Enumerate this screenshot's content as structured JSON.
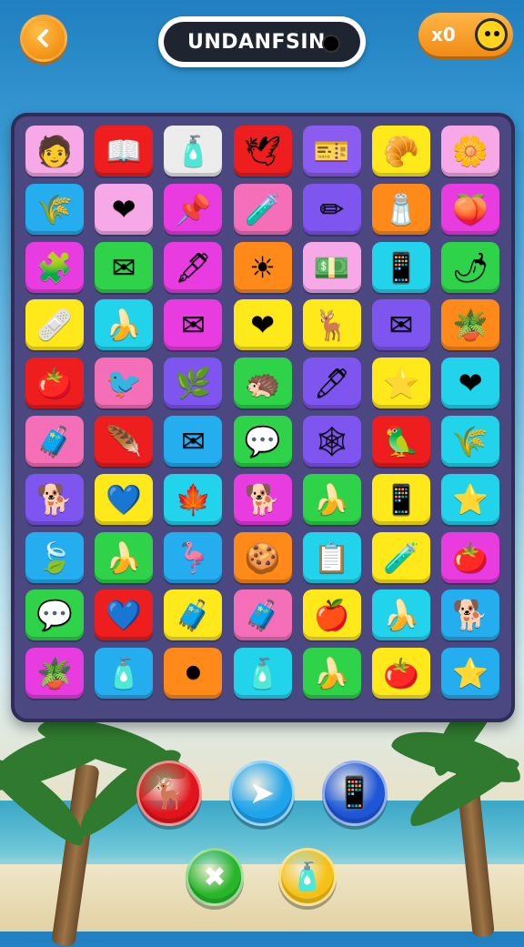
{
  "header": {
    "title": "UNDANFSIN",
    "coin_count": "x0",
    "back_icon": "back-arrow-icon"
  },
  "board": {
    "rows": [
      [
        {
          "icon": "🧑",
          "color": "#f7a8e6"
        },
        {
          "icon": "📖",
          "color": "#ef1e1e"
        },
        {
          "icon": "🧴",
          "color": "#ececec"
        },
        {
          "icon": "🕊",
          "color": "#ef1e1e"
        },
        {
          "icon": "🎫",
          "color": "#8a5cf0"
        },
        {
          "icon": "🥐",
          "color": "#ffe91a"
        },
        {
          "icon": "🌼",
          "color": "#f7a8e6"
        }
      ],
      [
        {
          "icon": "🌾",
          "color": "#24aef0"
        },
        {
          "icon": "❤",
          "color": "#f7a8e6"
        },
        {
          "icon": "📌",
          "color": "#e83be0"
        },
        {
          "icon": "🧪",
          "color": "#f56fb8"
        },
        {
          "icon": "✏",
          "color": "#7e55ee"
        },
        {
          "icon": "🧂",
          "color": "#ff8a1a"
        },
        {
          "icon": "🍑",
          "color": "#e83be0"
        }
      ],
      [
        {
          "icon": "🧩",
          "color": "#e83be0"
        },
        {
          "icon": "✉",
          "color": "#2ed34a"
        },
        {
          "icon": "🖋",
          "color": "#e83be0"
        },
        {
          "icon": "☀",
          "color": "#ff8a1a"
        },
        {
          "icon": "💵",
          "color": "#f7a8e6"
        },
        {
          "icon": "📱",
          "color": "#22d3ec"
        },
        {
          "icon": "🌶",
          "color": "#2ed34a"
        }
      ],
      [
        {
          "icon": "🩹",
          "color": "#ffe91a"
        },
        {
          "icon": "🍌",
          "color": "#22d3ec"
        },
        {
          "icon": "✉",
          "color": "#e83be0"
        },
        {
          "icon": "❤",
          "color": "#ffe91a"
        },
        {
          "icon": "🦌",
          "color": "#ffe91a"
        },
        {
          "icon": "✉",
          "color": "#7e55ee"
        },
        {
          "icon": "🪴",
          "color": "#ff8a1a"
        }
      ],
      [
        {
          "icon": "🍅",
          "color": "#ef1e1e"
        },
        {
          "icon": "🐦",
          "color": "#f56fb8"
        },
        {
          "icon": "🌿",
          "color": "#7e55ee"
        },
        {
          "icon": "🦔",
          "color": "#2ed34a"
        },
        {
          "icon": "🖊",
          "color": "#7e55ee"
        },
        {
          "icon": "⭐",
          "color": "#ffe91a"
        },
        {
          "icon": "❤",
          "color": "#22d3ec"
        }
      ],
      [
        {
          "icon": "🧳",
          "color": "#f56fb8"
        },
        {
          "icon": "🪶",
          "color": "#ef1e1e"
        },
        {
          "icon": "✉",
          "color": "#24aef0"
        },
        {
          "icon": "💬",
          "color": "#2ed34a"
        },
        {
          "icon": "🕸",
          "color": "#7e55ee"
        },
        {
          "icon": "🦜",
          "color": "#ef1e1e"
        },
        {
          "icon": "🌾",
          "color": "#22d3ec"
        }
      ],
      [
        {
          "icon": "🐕",
          "color": "#7e55ee"
        },
        {
          "icon": "💙",
          "color": "#ffe91a"
        },
        {
          "icon": "🍁",
          "color": "#22d3ec"
        },
        {
          "icon": "🐕",
          "color": "#e83be0"
        },
        {
          "icon": "🍌",
          "color": "#2ed34a"
        },
        {
          "icon": "📱",
          "color": "#ffe91a"
        },
        {
          "icon": "⭐",
          "color": "#22d3ec"
        }
      ],
      [
        {
          "icon": "🍃",
          "color": "#24aef0"
        },
        {
          "icon": "🍌",
          "color": "#2ed34a"
        },
        {
          "icon": "🦩",
          "color": "#24aef0"
        },
        {
          "icon": "🍪",
          "color": "#ff8a1a"
        },
        {
          "icon": "📋",
          "color": "#22d3ec"
        },
        {
          "icon": "🧪",
          "color": "#ffe91a"
        },
        {
          "icon": "🍅",
          "color": "#e83be0"
        }
      ],
      [
        {
          "icon": "💬",
          "color": "#2ed34a"
        },
        {
          "icon": "💙",
          "color": "#ef1e1e"
        },
        {
          "icon": "🧳",
          "color": "#ffe91a"
        },
        {
          "icon": "🧳",
          "color": "#f56fb8"
        },
        {
          "icon": "🍎",
          "color": "#ffe91a"
        },
        {
          "icon": "🍌",
          "color": "#22d3ec"
        },
        {
          "icon": "🐕",
          "color": "#24aef0"
        }
      ],
      [
        {
          "icon": "🪴",
          "color": "#e83be0"
        },
        {
          "icon": "🧴",
          "color": "#24aef0"
        },
        {
          "icon": "⚫",
          "color": "#ff8a1a"
        },
        {
          "icon": "🧴",
          "color": "#22d3ec"
        },
        {
          "icon": "🍌",
          "color": "#2ed34a"
        },
        {
          "icon": "🍅",
          "color": "#ffe91a"
        },
        {
          "icon": "⭐",
          "color": "#24aef0"
        }
      ]
    ]
  },
  "powerups": [
    {
      "name": "rocket-powerup-icon",
      "icon": "🦌",
      "color": "#e0141a"
    },
    {
      "name": "paper-plane-powerup-icon",
      "icon": "➤",
      "color": "#1fa3ec"
    },
    {
      "name": "phone-powerup-icon",
      "icon": "📱",
      "color": "#1f56d6"
    },
    {
      "name": "shuffle-powerup-icon",
      "icon": "✖",
      "color": "#27b52a"
    },
    {
      "name": "bottle-powerup-icon",
      "icon": "🧴",
      "color": "#f5c116"
    }
  ]
}
